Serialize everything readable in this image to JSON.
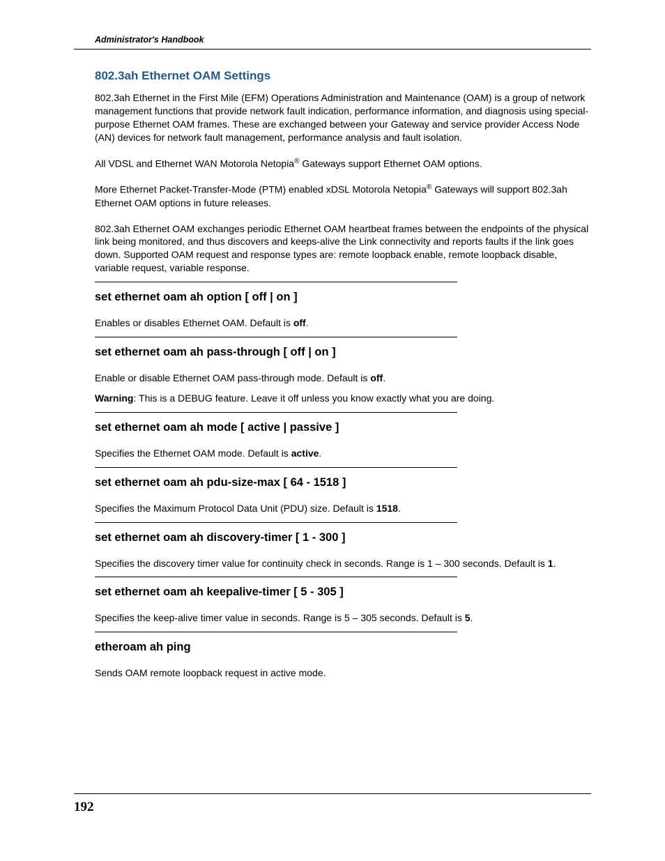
{
  "header": "Administrator's Handbook",
  "sectionTitle": "802.3ah Ethernet OAM Settings",
  "intro1": "802.3ah Ethernet in the First Mile (EFM) Operations Administration and Maintenance (OAM) is a group of network management functions that provide network fault indication, performance information, and diagnosis using special-purpose Ethernet OAM frames. These are exchanged between your Gateway and service provider Access Node (AN) devices for network fault management, performance analysis and fault isolation.",
  "intro2_pre": "All VDSL and Ethernet WAN Motorola Netopia",
  "intro2_post": " Gateways support Ethernet OAM options.",
  "intro3_pre": "More Ethernet Packet-Transfer-Mode (PTM) enabled xDSL Motorola Netopia",
  "intro3_post": " Gateways will support 802.3ah Ethernet OAM options in future releases.",
  "intro4": "802.3ah Ethernet OAM exchanges periodic Ethernet OAM heartbeat frames between the endpoints of the physical link being monitored, and thus discovers and keeps-alive the Link connectivity and reports faults if the link goes down. Supported OAM request and response types are: remote loopback enable, remote loopback disable, variable request, variable response.",
  "commands": [
    {
      "heading": "set ethernet oam ah option [ off | on ]",
      "desc_pre": "Enables or disables Ethernet OAM. Default is ",
      "desc_bold": "off",
      "desc_post": ".",
      "extra": null
    },
    {
      "heading": "set ethernet oam ah pass-through [ off | on ]",
      "desc_pre": "Enable or disable Ethernet OAM pass-through mode. Default is ",
      "desc_bold": "off",
      "desc_post": ".",
      "extra_bold": "Warning",
      "extra_post": ": This is a DEBUG feature. Leave it off unless you know exactly what you are doing."
    },
    {
      "heading": "set ethernet oam ah mode [ active | passive ]",
      "desc_pre": "Specifies the Ethernet OAM mode. Default is ",
      "desc_bold": "active",
      "desc_post": ".",
      "extra": null
    },
    {
      "heading": "set ethernet oam ah pdu-size-max [ 64 - 1518 ]",
      "desc_pre": "Specifies the Maximum Protocol Data Unit (PDU) size. Default is ",
      "desc_bold": "1518",
      "desc_post": ".",
      "extra": null
    },
    {
      "heading": "set ethernet oam ah discovery-timer [ 1 - 300 ]",
      "desc_pre": "Specifies the discovery timer value for continuity check in seconds. Range is 1 – 300 seconds. Default is ",
      "desc_bold": "1",
      "desc_post": ".",
      "extra": null
    },
    {
      "heading": "set ethernet oam ah keepalive-timer [ 5 - 305 ]",
      "desc_pre": "Specifies the keep-alive timer value in seconds. Range is 5 – 305 seconds. Default is ",
      "desc_bold": "5",
      "desc_post": ".",
      "extra": null
    },
    {
      "heading": "etheroam ah ping",
      "desc_pre": "Sends OAM remote loopback request in active mode.",
      "desc_bold": "",
      "desc_post": "",
      "extra": null,
      "noDivider": true
    }
  ],
  "pageNumber": "192"
}
